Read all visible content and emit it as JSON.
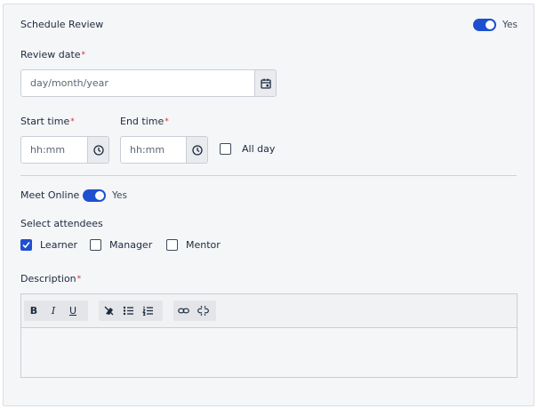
{
  "schedule": {
    "title": "Schedule Review",
    "toggle_label": "Yes"
  },
  "review_date": {
    "label": "Review date",
    "required": "*",
    "placeholder": "day/month/year"
  },
  "start_time": {
    "label": "Start time",
    "required": "*",
    "placeholder": "hh:mm"
  },
  "end_time": {
    "label": "End time",
    "required": "*",
    "placeholder": "hh:mm"
  },
  "all_day": {
    "label": "All day",
    "checked": false
  },
  "meet_online": {
    "label": "Meet Online",
    "toggle_label": "Yes"
  },
  "attendees": {
    "label": "Select attendees",
    "options": [
      {
        "label": "Learner",
        "checked": true
      },
      {
        "label": "Manager",
        "checked": false
      },
      {
        "label": "Mentor",
        "checked": false
      }
    ]
  },
  "description": {
    "label": "Description",
    "required": "*",
    "toolbar": {
      "bold": "B",
      "italic": "I",
      "underline": "U"
    }
  },
  "colors": {
    "accent": "#1f4fd1",
    "required": "#d32f2f"
  }
}
